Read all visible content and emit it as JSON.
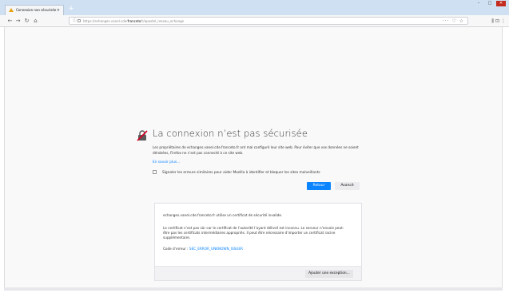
{
  "browser": {
    "tab_title": "Connexion non sécurisée",
    "tab_close": "×",
    "new_tab": "+",
    "url_prefix": "https://echanges.vanel.cde/",
    "url_host": "franceto",
    "url_suffix": "fr/apostel_reseau_echange",
    "url_right_icons": "··· ♡ ☆",
    "right_icons": "⫼ ⊡ ⋮",
    "win_min": "–",
    "win_max": "□",
    "win_close": "✕"
  },
  "error": {
    "title": "La connexion n’est pas sécurisée",
    "description": "Les propriétaires de echanges.vanel.cde.franceto.fr ont mal configuré leur site web. Pour éviter que vos données ne soient dérobées, Firefox ne s’est pas connecté à ce site web.",
    "learn_more": "En savoir plus…",
    "report_label": "Signaler les erreurs similaires pour aider Mozilla à identifier et bloquer les sites malveillants",
    "back_button": "Retour",
    "advanced_button": "Avancé"
  },
  "advanced": {
    "line1": "echanges.vanel.cde.franceto.fr utilise un certificat de sécurité invalide.",
    "line2": "Le certificat n’est pas sûr car le certificat de l’autorité l’ayant délivré est inconnu. Le serveur n’envoie peut-être pas les certificats intermédiaires appropriés. Il peut être nécessaire d’importer un certificat racine supplémentaire.",
    "code_label": "Code d’erreur : ",
    "code_value": "SEC_ERROR_UNKNOWN_ISSUER",
    "exception_button": "Ajouter une exception…"
  },
  "colors": {
    "accent": "#0a84ff",
    "warning": "#e6a116"
  }
}
